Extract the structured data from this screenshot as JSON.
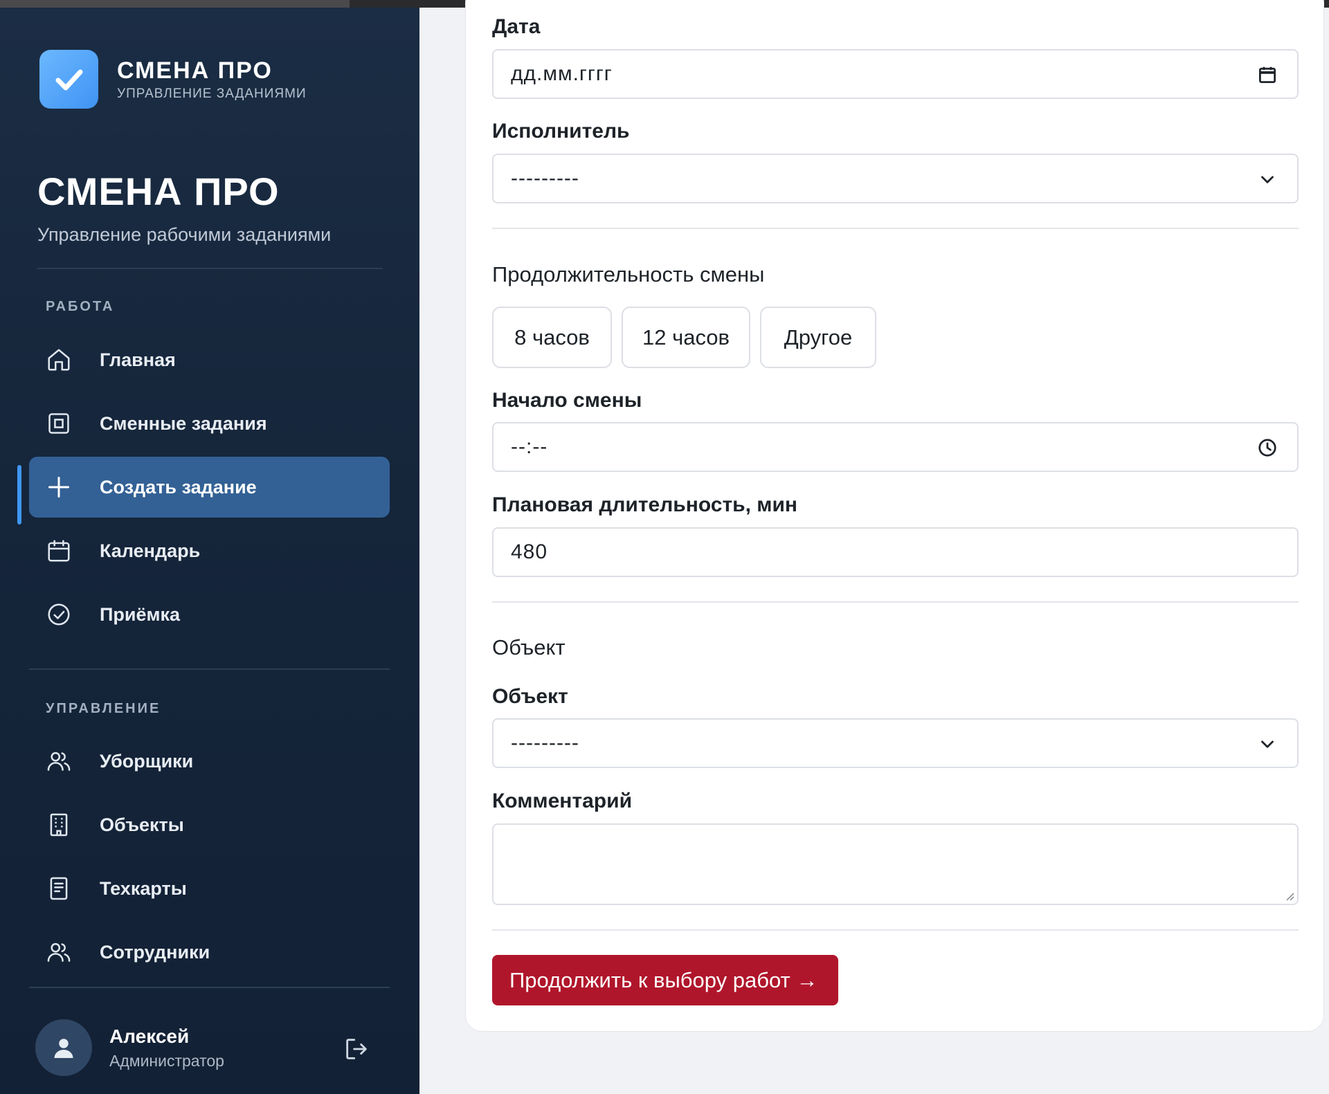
{
  "sidebar": {
    "brand_name": "СМЕНА ПРО",
    "brand_subtitle": "УПРАВЛЕНИЕ ЗАДАНИЯМИ",
    "title": "СМЕНА ПРО",
    "subtitle": "Управление рабочими заданиями",
    "section_work": "РАБОТА",
    "section_manage": "УПРАВЛЕНИЕ",
    "work_items": [
      {
        "label": "Главная",
        "icon": "home-icon"
      },
      {
        "label": "Сменные задания",
        "icon": "task-square-icon"
      },
      {
        "label": "Создать задание",
        "icon": "plus-icon",
        "active": true
      },
      {
        "label": "Календарь",
        "icon": "calendar-icon"
      },
      {
        "label": "Приёмка",
        "icon": "check-circle-icon"
      }
    ],
    "manage_items": [
      {
        "label": "Уборщики",
        "icon": "users-icon"
      },
      {
        "label": "Объекты",
        "icon": "building-icon"
      },
      {
        "label": "Техкарты",
        "icon": "document-icon"
      },
      {
        "label": "Сотрудники",
        "icon": "users-icon"
      }
    ],
    "user": {
      "name": "Алексей",
      "role": "Администратор"
    }
  },
  "form": {
    "date_label": "Дата",
    "date_placeholder": "дд.мм.гггг",
    "executor_label": "Исполнитель",
    "executor_value": "---------",
    "duration_section": "Продолжительность смены",
    "duration_options": [
      "8 часов",
      "12 часов",
      "Другое"
    ],
    "start_label": "Начало смены",
    "start_placeholder": "--:--",
    "planned_label": "Плановая длительность, мин",
    "planned_value": "480",
    "object_section": "Объект",
    "object_label": "Объект",
    "object_value": "---------",
    "comment_label": "Комментарий",
    "comment_value": "",
    "submit_label": "Продолжить к выбору работ →"
  },
  "colors": {
    "sidebar_bg": "#15253a",
    "active_item": "#336195",
    "accent_bar": "#3e97f5",
    "primary_button": "#b0162b",
    "brand_logo": "#4ea2f7"
  }
}
